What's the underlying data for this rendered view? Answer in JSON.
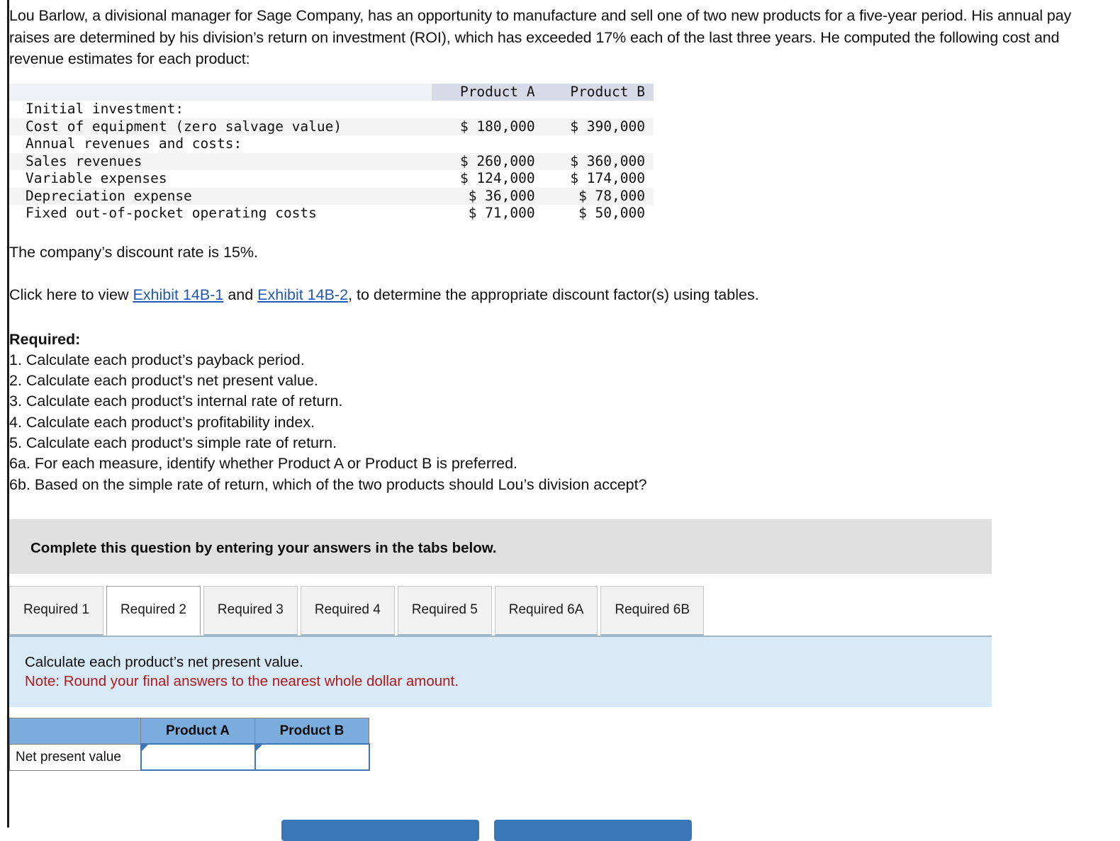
{
  "problem": {
    "paragraph": "Lou Barlow, a divisional manager for Sage Company, has an opportunity to manufacture and sell one of two new products for a five-year period. His annual pay raises are determined by his division’s return on investment (ROI), which has exceeded 17% each of the last three years. He computed the following cost and revenue estimates for each product:",
    "discount_rate_text": "The company’s discount rate is 15%.",
    "links_prefix": "Click here to view ",
    "link_1": "Exhibit 14B-1",
    "links_middle": " and ",
    "link_2": "Exhibit 14B-2",
    "links_suffix": ", to determine the appropriate discount factor(s) using tables."
  },
  "estimates_table": {
    "columns": [
      "",
      "Product A",
      "Product B"
    ],
    "rows": [
      {
        "label": "Initial investment:",
        "a": "",
        "b": "",
        "style": "plain"
      },
      {
        "label": "Cost of equipment (zero salvage value)",
        "a": "$ 180,000",
        "b": "$ 390,000",
        "style": "shade"
      },
      {
        "label": "Annual revenues and costs:",
        "a": "",
        "b": "",
        "style": "plain"
      },
      {
        "label": "Sales revenues",
        "a": "$ 260,000",
        "b": "$ 360,000",
        "style": "shade"
      },
      {
        "label": "Variable expenses",
        "a": "$ 124,000",
        "b": "$ 174,000",
        "style": "plain"
      },
      {
        "label": "Depreciation expense",
        "a": "$ 36,000",
        "b": "$ 78,000",
        "style": "shade"
      },
      {
        "label": "Fixed out-of-pocket operating costs",
        "a": "$ 71,000",
        "b": "$ 50,000",
        "style": "plain"
      }
    ]
  },
  "required": {
    "title": "Required:",
    "items": [
      "1. Calculate each product’s payback period.",
      "2. Calculate each product’s net present value.",
      "3. Calculate each product’s internal rate of return.",
      "4. Calculate each product’s profitability index.",
      "5. Calculate each product’s simple rate of return.",
      "6a. For each measure, identify whether Product A or Product B is preferred.",
      "6b. Based on the simple rate of return, which of the two products should Lou’s division accept?"
    ]
  },
  "banner": {
    "text": "Complete this question by entering your answers in the tabs below."
  },
  "tabs": {
    "items": [
      {
        "label": "Required 1",
        "active": false
      },
      {
        "label": "Required 2",
        "active": true
      },
      {
        "label": "Required 3",
        "active": false
      },
      {
        "label": "Required 4",
        "active": false
      },
      {
        "label": "Required 5",
        "active": false
      },
      {
        "label": "Required 6A",
        "active": false
      },
      {
        "label": "Required 6B",
        "active": false
      }
    ]
  },
  "instruction_panel": {
    "prompt": "Calculate each product’s net present value.",
    "note": "Note: Round your final answers to the nearest whole dollar amount."
  },
  "answer_table": {
    "blank_header": "",
    "col_a": "Product A",
    "col_b": "Product B",
    "row_label": "Net present value",
    "value_a": "",
    "value_b": "",
    "placeholder": ""
  },
  "footer_buttons": {
    "left_label": "",
    "right_label": ""
  },
  "colors": {
    "link": "#2457b5",
    "note_red": "#b01a1a",
    "table_header_blue": "#d6dbe7",
    "answer_header_blue": "#7aaddd",
    "panel_blue": "#d8e9f7",
    "banner_gray": "#e0e0e0",
    "button_blue": "#3a76b8"
  }
}
